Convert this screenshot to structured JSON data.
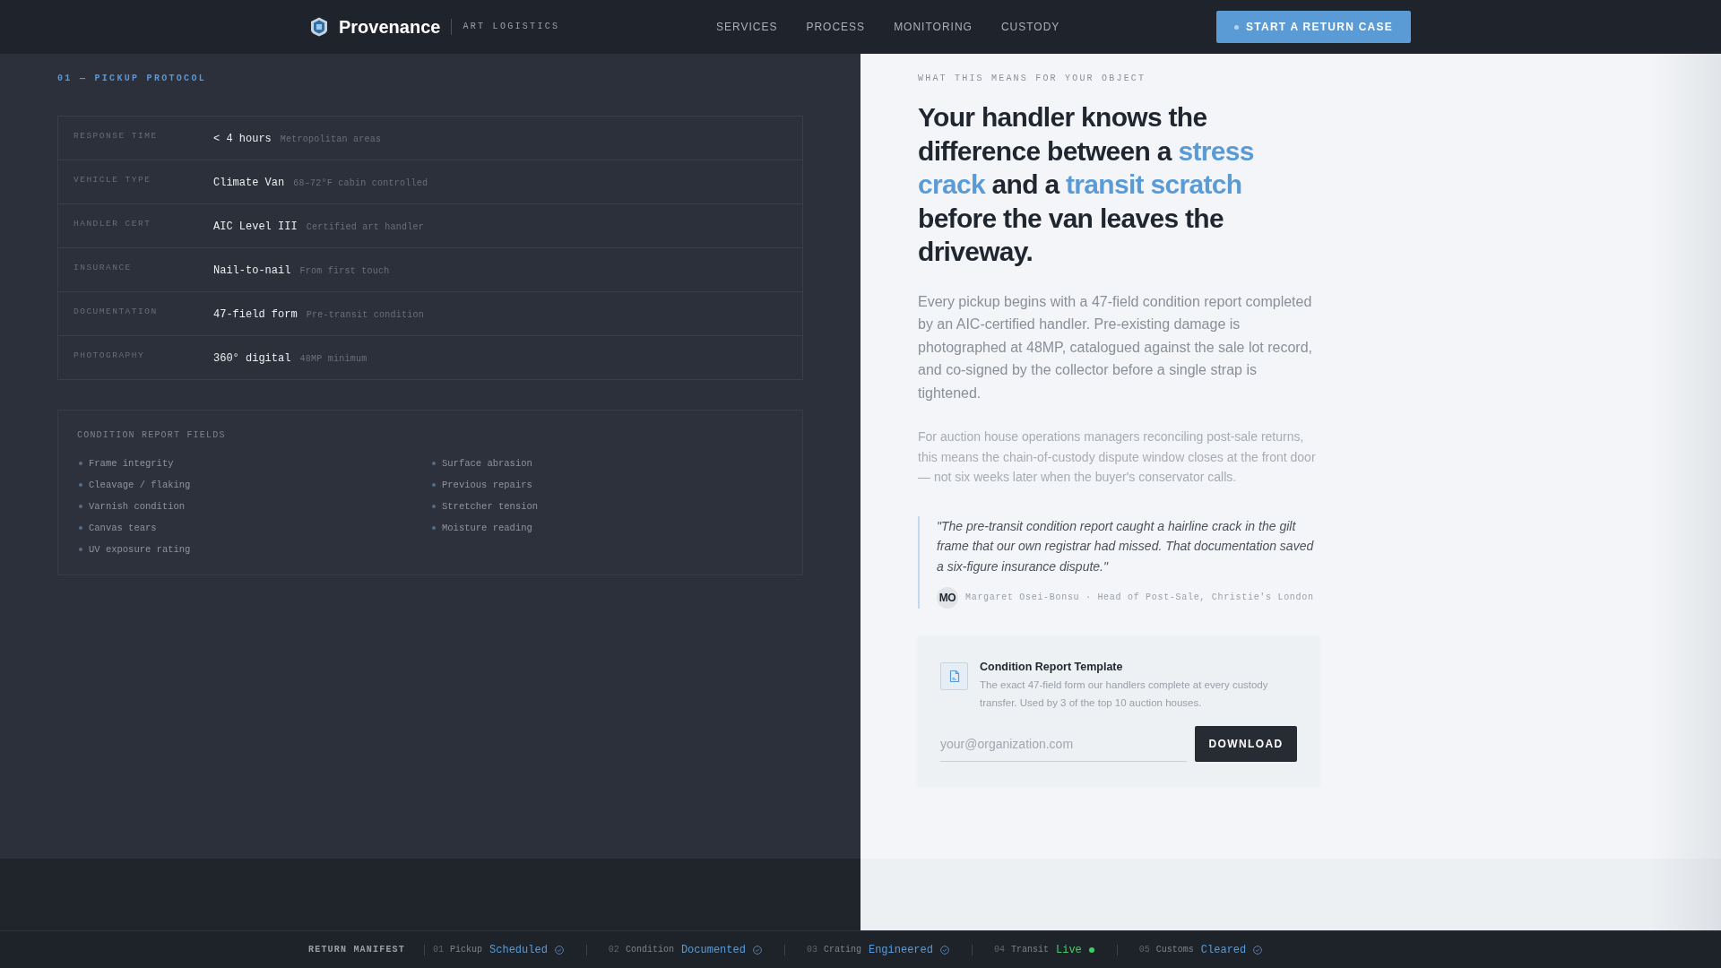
{
  "header": {
    "brand": "Provenance",
    "tagline": "ART LOGISTICS",
    "nav": [
      "SERVICES",
      "PROCESS",
      "MONITORING",
      "CUSTODY"
    ],
    "cta": "START A RETURN CASE"
  },
  "protocol": {
    "label": "01 — PICKUP PROTOCOL",
    "rows": [
      {
        "label": "RESPONSE TIME",
        "value": "< 4 hours",
        "note": "Metropolitan areas"
      },
      {
        "label": "VEHICLE TYPE",
        "value": "Climate Van",
        "note": "68–72°F cabin controlled"
      },
      {
        "label": "HANDLER CERT",
        "value": "AIC Level III",
        "note": "Certified art handler"
      },
      {
        "label": "INSURANCE",
        "value": "Nail-to-nail",
        "note": "From first touch"
      },
      {
        "label": "DOCUMENTATION",
        "value": "47-field form",
        "note": "Pre-transit condition"
      },
      {
        "label": "PHOTOGRAPHY",
        "value": "360° digital",
        "note": "48MP minimum"
      }
    ]
  },
  "condition_fields": {
    "title": "CONDITION REPORT FIELDS",
    "items": [
      "Frame integrity",
      "Cleavage / flaking",
      "Varnish condition",
      "Canvas tears",
      "UV exposure rating",
      "Surface abrasion",
      "Previous repairs",
      "Stretcher tension",
      "Moisture reading"
    ]
  },
  "explainer": {
    "eyebrow": "WHAT THIS MEANS FOR YOUR OBJECT",
    "headline": [
      {
        "text": "Your handler knows the difference between a ",
        "kind": "plain"
      },
      {
        "text": "stress crack",
        "kind": "accent"
      },
      {
        "text": " and a ",
        "kind": "plain"
      },
      {
        "text": "transit scratch",
        "kind": "accent"
      },
      {
        "text": " before the van leaves the driveway.",
        "kind": "plain"
      }
    ],
    "body": "Every pickup begins with a 47-field condition report completed by an AIC-certified handler. Pre-existing damage is photographed at 48MP, catalogued against the sale lot record, and co-signed by the collector before a single strap is tightened.",
    "aside": "For auction house operations managers reconciling post-sale returns, this means the chain-of-custody dispute window closes at the front door — not six weeks later when the buyer's conservator calls.",
    "quote": {
      "text": "\"The pre-transit condition report caught a hairline crack in the gilt frame that our own registrar had missed. That documentation saved a six-figure insurance dispute.\"",
      "initials": "MO",
      "attribution": "Margaret Osei-Bonsu · Head of Post-Sale, Christie's London"
    },
    "template_card": {
      "title": "Condition Report Template",
      "description": "The exact 47-field form our handlers complete at every custody transfer. Used by 3 of the top 10 auction houses.",
      "email_placeholder": "your@organization.com",
      "button": "DOWNLOAD"
    }
  },
  "manifest": {
    "title": "RETURN MANIFEST",
    "steps": [
      {
        "number": "01",
        "label": "Pickup",
        "status": "Scheduled",
        "kind": "complete"
      },
      {
        "number": "02",
        "label": "Condition",
        "status": "Documented",
        "kind": "complete"
      },
      {
        "number": "03",
        "label": "Crating",
        "status": "Engineered",
        "kind": "complete"
      },
      {
        "number": "04",
        "label": "Transit",
        "status": "Live",
        "kind": "live"
      },
      {
        "number": "05",
        "label": "Customs",
        "status": "Cleared",
        "kind": "complete"
      }
    ]
  }
}
